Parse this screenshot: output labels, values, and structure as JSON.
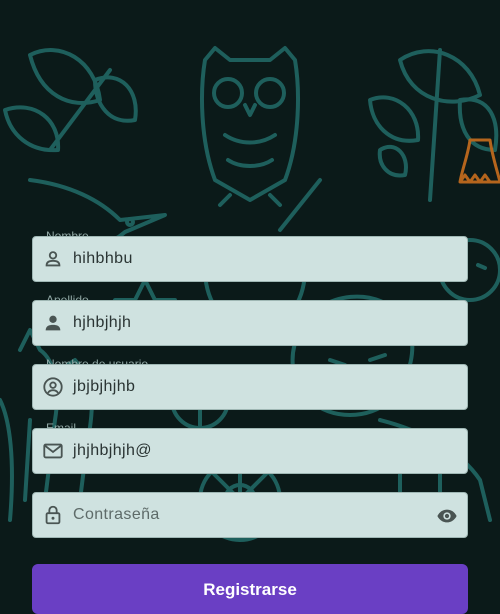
{
  "form": {
    "fields": [
      {
        "label": "Nombre",
        "value": "hihbhbu",
        "icon": "person-icon"
      },
      {
        "label": "Apellido",
        "value": "hjhbjhjh",
        "icon": "person-filled-icon"
      },
      {
        "label": "Nombre de usuario",
        "value": "jbjbjhjhb",
        "icon": "account-circle-icon"
      },
      {
        "label": "Email",
        "value": "jhjhbjhjh@",
        "icon": "mail-icon"
      },
      {
        "label": "",
        "value": "",
        "placeholder": "Contraseña",
        "icon": "lock-icon"
      }
    ],
    "register_label": "Registrarse"
  },
  "colors": {
    "background": "#0b1a19",
    "illustration_line": "#1e5f5c",
    "field_fill": "#cfe2e0",
    "button": "#6a3fc4",
    "accent_flower": "#b5651d"
  }
}
